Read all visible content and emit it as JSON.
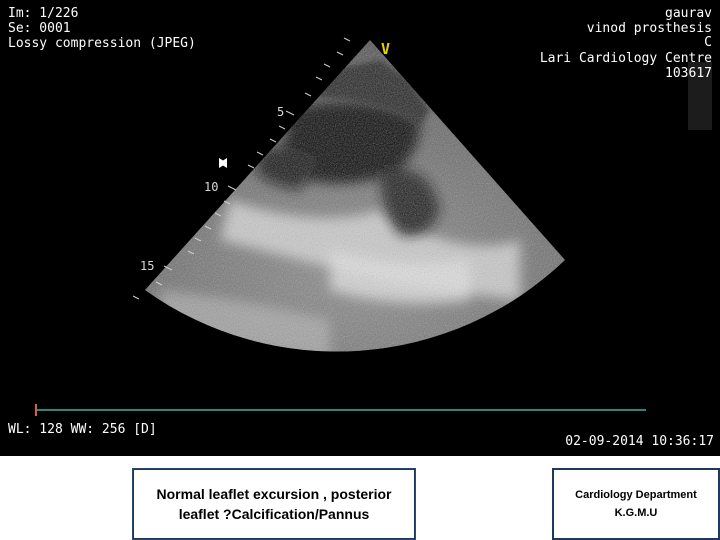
{
  "overlay": {
    "image_index": "Im: 1/226",
    "series": "Se: 0001",
    "compression": "Lossy compression (JPEG)",
    "patient_name": "gaurav",
    "study_desc": "vinod prosthesis",
    "study_desc_2": "C",
    "institution": "Lari Cardiology Centre",
    "patient_id": "103617",
    "marker": "V",
    "window_level": "WL: 128 WW: 256 [D]",
    "datetime": "02-09-2014 10:36:17"
  },
  "depth_scale": {
    "labels": [
      "5",
      "10",
      "15"
    ]
  },
  "captions": {
    "left": "Normal leaflet excursion , posterior\nleaflet ?Calcification/Pannus",
    "right": "Cardiology Department\nK.G.M.U"
  },
  "colors": {
    "background": "#000000",
    "overlay_text": "#ffffff",
    "marker": "#e8d200",
    "scale_bar": "#3ab3a8",
    "caption_border": "#1f3a5f"
  },
  "icons": {
    "focus_marker": "bowtie-icon"
  }
}
